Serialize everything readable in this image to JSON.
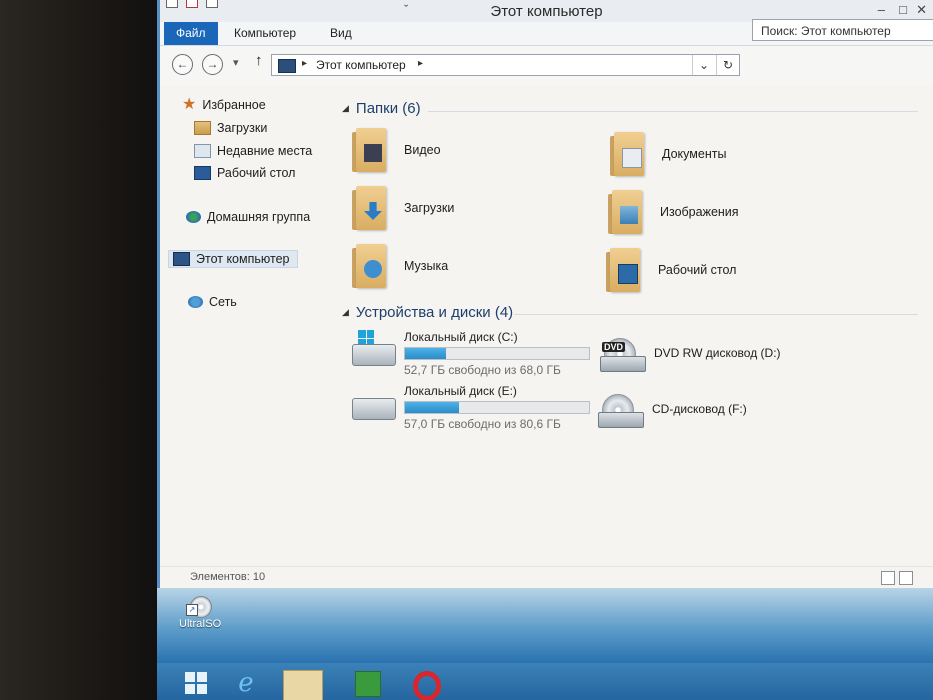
{
  "window": {
    "title": "Этот компьютер",
    "controls": {
      "minimize": "–",
      "maximize": "□",
      "close": "✕"
    }
  },
  "ribbon": {
    "tabs": [
      {
        "label": "Файл",
        "active": true
      },
      {
        "label": "Компьютер",
        "active": false
      },
      {
        "label": "Вид",
        "active": false
      }
    ],
    "expand_glyph": "⌄"
  },
  "navbar": {
    "back_glyph": "←",
    "forward_glyph": "→",
    "recent_glyph": "▾",
    "up_glyph": "↑",
    "address": "Этот компьютер",
    "address_sep": "▸",
    "dropdown_glyph": "⌄",
    "refresh_glyph": "↻",
    "search_placeholder": "Поиск: Этот компьютер",
    "search_icon": "⌕"
  },
  "nav_pane": {
    "favorites": "Избранное",
    "downloads": "Загрузки",
    "recent": "Недавние места",
    "desktop": "Рабочий стол",
    "homegroup": "Домашняя группа",
    "this_pc": "Этот компьютер",
    "network": "Сеть"
  },
  "content": {
    "folders_group": "Папки (6)",
    "folders": [
      {
        "label": "Видео",
        "icon": "video-folder-icon"
      },
      {
        "label": "Документы",
        "icon": "documents-folder-icon"
      },
      {
        "label": "Загрузки",
        "icon": "downloads-folder-icon"
      },
      {
        "label": "Изображения",
        "icon": "pictures-folder-icon"
      },
      {
        "label": "Музыка",
        "icon": "music-folder-icon"
      },
      {
        "label": "Рабочий стол",
        "icon": "desktop-folder-icon"
      }
    ],
    "devices_group": "Устройства и диски (4)",
    "drives": [
      {
        "name": "Локальный диск (C:)",
        "free": "52,7 ГБ свободно из 68,0 ГБ",
        "used_fraction": 0.225
      },
      {
        "name": "Локальный диск (E:)",
        "free": "57,0 ГБ свободно из 80,6 ГБ",
        "used_fraction": 0.293
      }
    ],
    "optical": [
      {
        "name": "DVD RW дисковод (D:)",
        "tag": "DVD"
      },
      {
        "name": "CD-дисковод (F:)"
      }
    ]
  },
  "statusbar": {
    "items": "Элементов: 10"
  },
  "desktop": {
    "icon_label": "UltraISO"
  },
  "taskbar": {
    "ie_glyph": "e"
  },
  "colors": {
    "accent": "#1a66b8",
    "progress": "#2a8cc9",
    "group_header": "#1e3f6e"
  }
}
